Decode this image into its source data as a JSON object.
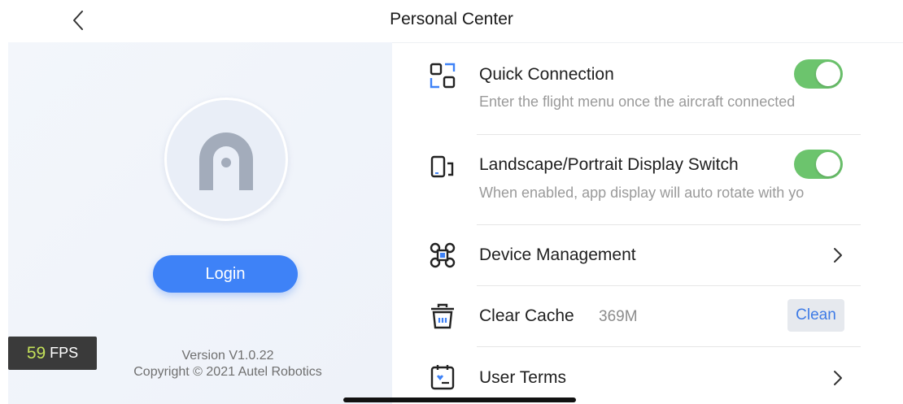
{
  "header": {
    "title": "Personal Center",
    "back_icon": "chevron-left-icon"
  },
  "left_panel": {
    "avatar_icon": "autel-logo-icon",
    "login_label": "Login",
    "version_text": "Version V1.0.22",
    "copyright_text": "Copyright © 2021 Autel Robotics"
  },
  "fps_overlay": {
    "value": "59",
    "unit": "FPS"
  },
  "settings": [
    {
      "icon": "quick-connect-icon",
      "title": "Quick Connection",
      "subtitle": "Enter the flight menu once the aircraft connected",
      "control": "toggle",
      "enabled": true
    },
    {
      "icon": "rotate-device-icon",
      "title": "Landscape/Portrait Display Switch",
      "subtitle": "When enabled, app display will auto rotate with yo",
      "control": "toggle",
      "enabled": true
    },
    {
      "icon": "drone-icon",
      "title": "Device Management",
      "control": "chevron"
    },
    {
      "icon": "trash-icon",
      "title": "Clear Cache",
      "value": "369M",
      "control": "button",
      "button_label": "Clean"
    },
    {
      "icon": "document-icon",
      "title": "User Terms",
      "control": "chevron"
    }
  ],
  "colors": {
    "accent_blue": "#3e82f7",
    "toggle_on": "#6cc46d",
    "fps_green": "#c4e15a"
  }
}
